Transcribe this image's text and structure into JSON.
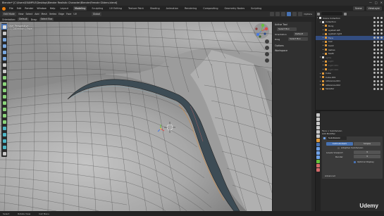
{
  "window": {
    "title": "Blender* [C:\\Users\\EXAMPLE\\Desktop\\Blender Realistic Character\\Blender\\Female Gliders.blend]",
    "controls": [
      "—",
      "□",
      "✕"
    ]
  },
  "menubar": {
    "items": [
      "File",
      "Edit",
      "Render",
      "Window",
      "Help"
    ],
    "workspaces": [
      "Layout",
      "Modeling",
      "Sculpting",
      "UV Editing",
      "Texture Paint",
      "Shading",
      "Animation",
      "Rendering",
      "Compositing",
      "Geometry Nodes",
      "Scripting"
    ],
    "active_workspace": "Modeling",
    "scene_label": "Scene",
    "viewlayer_label": "ViewLayer"
  },
  "header": {
    "mode": "Edit Mode",
    "view": "View",
    "select": "Select",
    "add": "Add",
    "mesh": "Mesh",
    "vertex": "Vertex",
    "edge": "Edge",
    "face": "Face",
    "uv": "UV",
    "transform": "Global",
    "options": "Options"
  },
  "toolrow": {
    "orientation_label": "Orientation:",
    "orientation_value": "Default",
    "drag_label": "Drag:",
    "drag_value": "Select Box"
  },
  "viewport": {
    "info_line1": "User Perspective",
    "info_line2": "(1) Collection | Face"
  },
  "sidepanel": {
    "active_tool": "Active Tool",
    "select_box": "Select Box",
    "orientation_label": "Orientation",
    "orientation_value": "Default",
    "drag_label": "Drag",
    "drag_value": "Select Box",
    "options": "Options",
    "workspace": "Workspace"
  },
  "outliner": {
    "search_placeholder": "",
    "rows": [
      {
        "label": "Scene Collection",
        "type": "col",
        "dim": false,
        "sel": false,
        "indent": 0
      },
      {
        "label": "Collection",
        "type": "col",
        "dim": false,
        "sel": false,
        "indent": 1
      },
      {
        "label": "Body",
        "type": "obj",
        "dim": false,
        "sel": false,
        "indent": 2
      },
      {
        "label": "eyeball.left",
        "type": "obj",
        "dim": false,
        "sel": false,
        "indent": 2
      },
      {
        "label": "eyeball.right",
        "type": "obj",
        "dim": false,
        "sel": false,
        "indent": 2
      },
      {
        "label": "Face",
        "type": "obj",
        "dim": false,
        "sel": true,
        "indent": 2
      },
      {
        "label": "hair",
        "type": "obj",
        "dim": false,
        "sel": false,
        "indent": 2
      },
      {
        "label": "hair2",
        "type": "obj",
        "dim": false,
        "sel": false,
        "indent": 2
      },
      {
        "label": "lashes",
        "type": "obj",
        "dim": false,
        "sel": false,
        "indent": 2
      },
      {
        "label": "teeth",
        "type": "obj",
        "dim": false,
        "sel": false,
        "indent": 2
      },
      {
        "label": "lights",
        "type": "col",
        "dim": true,
        "sel": false,
        "indent": 1
      },
      {
        "label": "Light",
        "type": "obj",
        "dim": true,
        "sel": false,
        "indent": 2
      },
      {
        "label": "Light.001",
        "type": "obj",
        "dim": true,
        "sel": false,
        "indent": 2
      },
      {
        "label": "Light.002",
        "type": "obj",
        "dim": true,
        "sel": false,
        "indent": 2
      },
      {
        "label": "Cube",
        "type": "obj",
        "dim": false,
        "sel": false,
        "indent": 1
      },
      {
        "label": "Cube.001",
        "type": "obj",
        "dim": false,
        "sel": false,
        "indent": 1
      },
      {
        "label": "reference.001",
        "type": "obj",
        "dim": false,
        "sel": false,
        "indent": 1
      },
      {
        "label": "reference.002",
        "type": "obj",
        "dim": false,
        "sel": false,
        "indent": 1
      },
      {
        "label": "Sweater",
        "type": "obj",
        "dim": false,
        "sel": false,
        "indent": 1
      }
    ]
  },
  "properties": {
    "breadcrumb": "Face  >  Subdivision",
    "add_modifier": "Add Modifier",
    "modifier_name": "Subdivision",
    "catmull": "Catmull-Clark",
    "simple": "Simple",
    "adaptive": "Adaptive Subdivision",
    "levels_viewport_label": "Levels Viewport",
    "levels_viewport_value": "3",
    "render_label": "Render",
    "render_value": "3",
    "optimal_display": "Optimal Display",
    "advanced": "Advanced"
  },
  "statusbar": {
    "select": "Select",
    "rotate": "Rotate View",
    "menu": "Call Menu"
  },
  "watermark": "Udemy",
  "colors": {
    "accent": "#4772b3",
    "orange": "#e87d0d",
    "selected_row": "#334d80"
  }
}
